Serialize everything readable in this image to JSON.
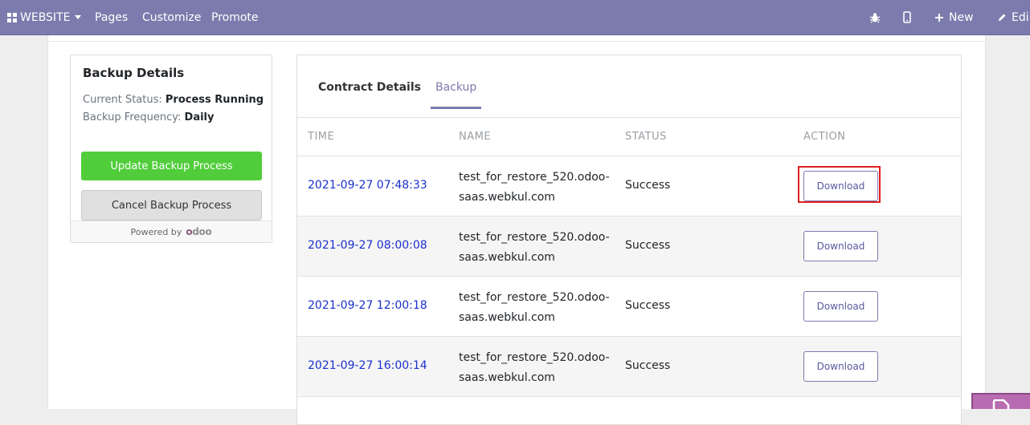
{
  "navbar": {
    "app_label": "WEBSITE",
    "menu": [
      "Pages",
      "Customize",
      "Promote"
    ],
    "new_label": "New",
    "edit_label": "Edi"
  },
  "backup_details": {
    "title": "Backup Details",
    "status_label": "Current Status:",
    "status_value": "Process Running",
    "frequency_label": "Backup Frequency:",
    "frequency_value": "Daily",
    "update_button": "Update Backup Process",
    "cancel_button": "Cancel Backup Process",
    "powered_by": "Powered by",
    "logo_text": "odoo"
  },
  "tabs": [
    "Contract Details",
    "Backup"
  ],
  "table": {
    "headers": [
      "TIME",
      "NAME",
      "STATUS",
      "ACTION"
    ],
    "rows": [
      {
        "time": "2021-09-27 07:48:33",
        "name": "test_for_restore_520.odoo-saas.webkul.com",
        "status": "Success",
        "action": "Download"
      },
      {
        "time": "2021-09-27 08:00:08",
        "name": "test_for_restore_520.odoo-saas.webkul.com",
        "status": "Success",
        "action": "Download"
      },
      {
        "time": "2021-09-27 12:00:18",
        "name": "test_for_restore_520.odoo-saas.webkul.com",
        "status": "Success",
        "action": "Download"
      },
      {
        "time": "2021-09-27 16:00:14",
        "name": "test_for_restore_520.odoo-saas.webkul.com",
        "status": "Success",
        "action": "Download"
      }
    ]
  },
  "colors": {
    "navbar": "#7c7bad",
    "accent": "#7c7bad",
    "update_button": "#51cd3c",
    "link": "#1a2fcc",
    "highlight": "#e02020"
  },
  "icons": [
    "apps-grid-icon",
    "bug-icon",
    "mobile-icon",
    "plus-icon",
    "pencil-icon",
    "edit-widget-icon"
  ]
}
